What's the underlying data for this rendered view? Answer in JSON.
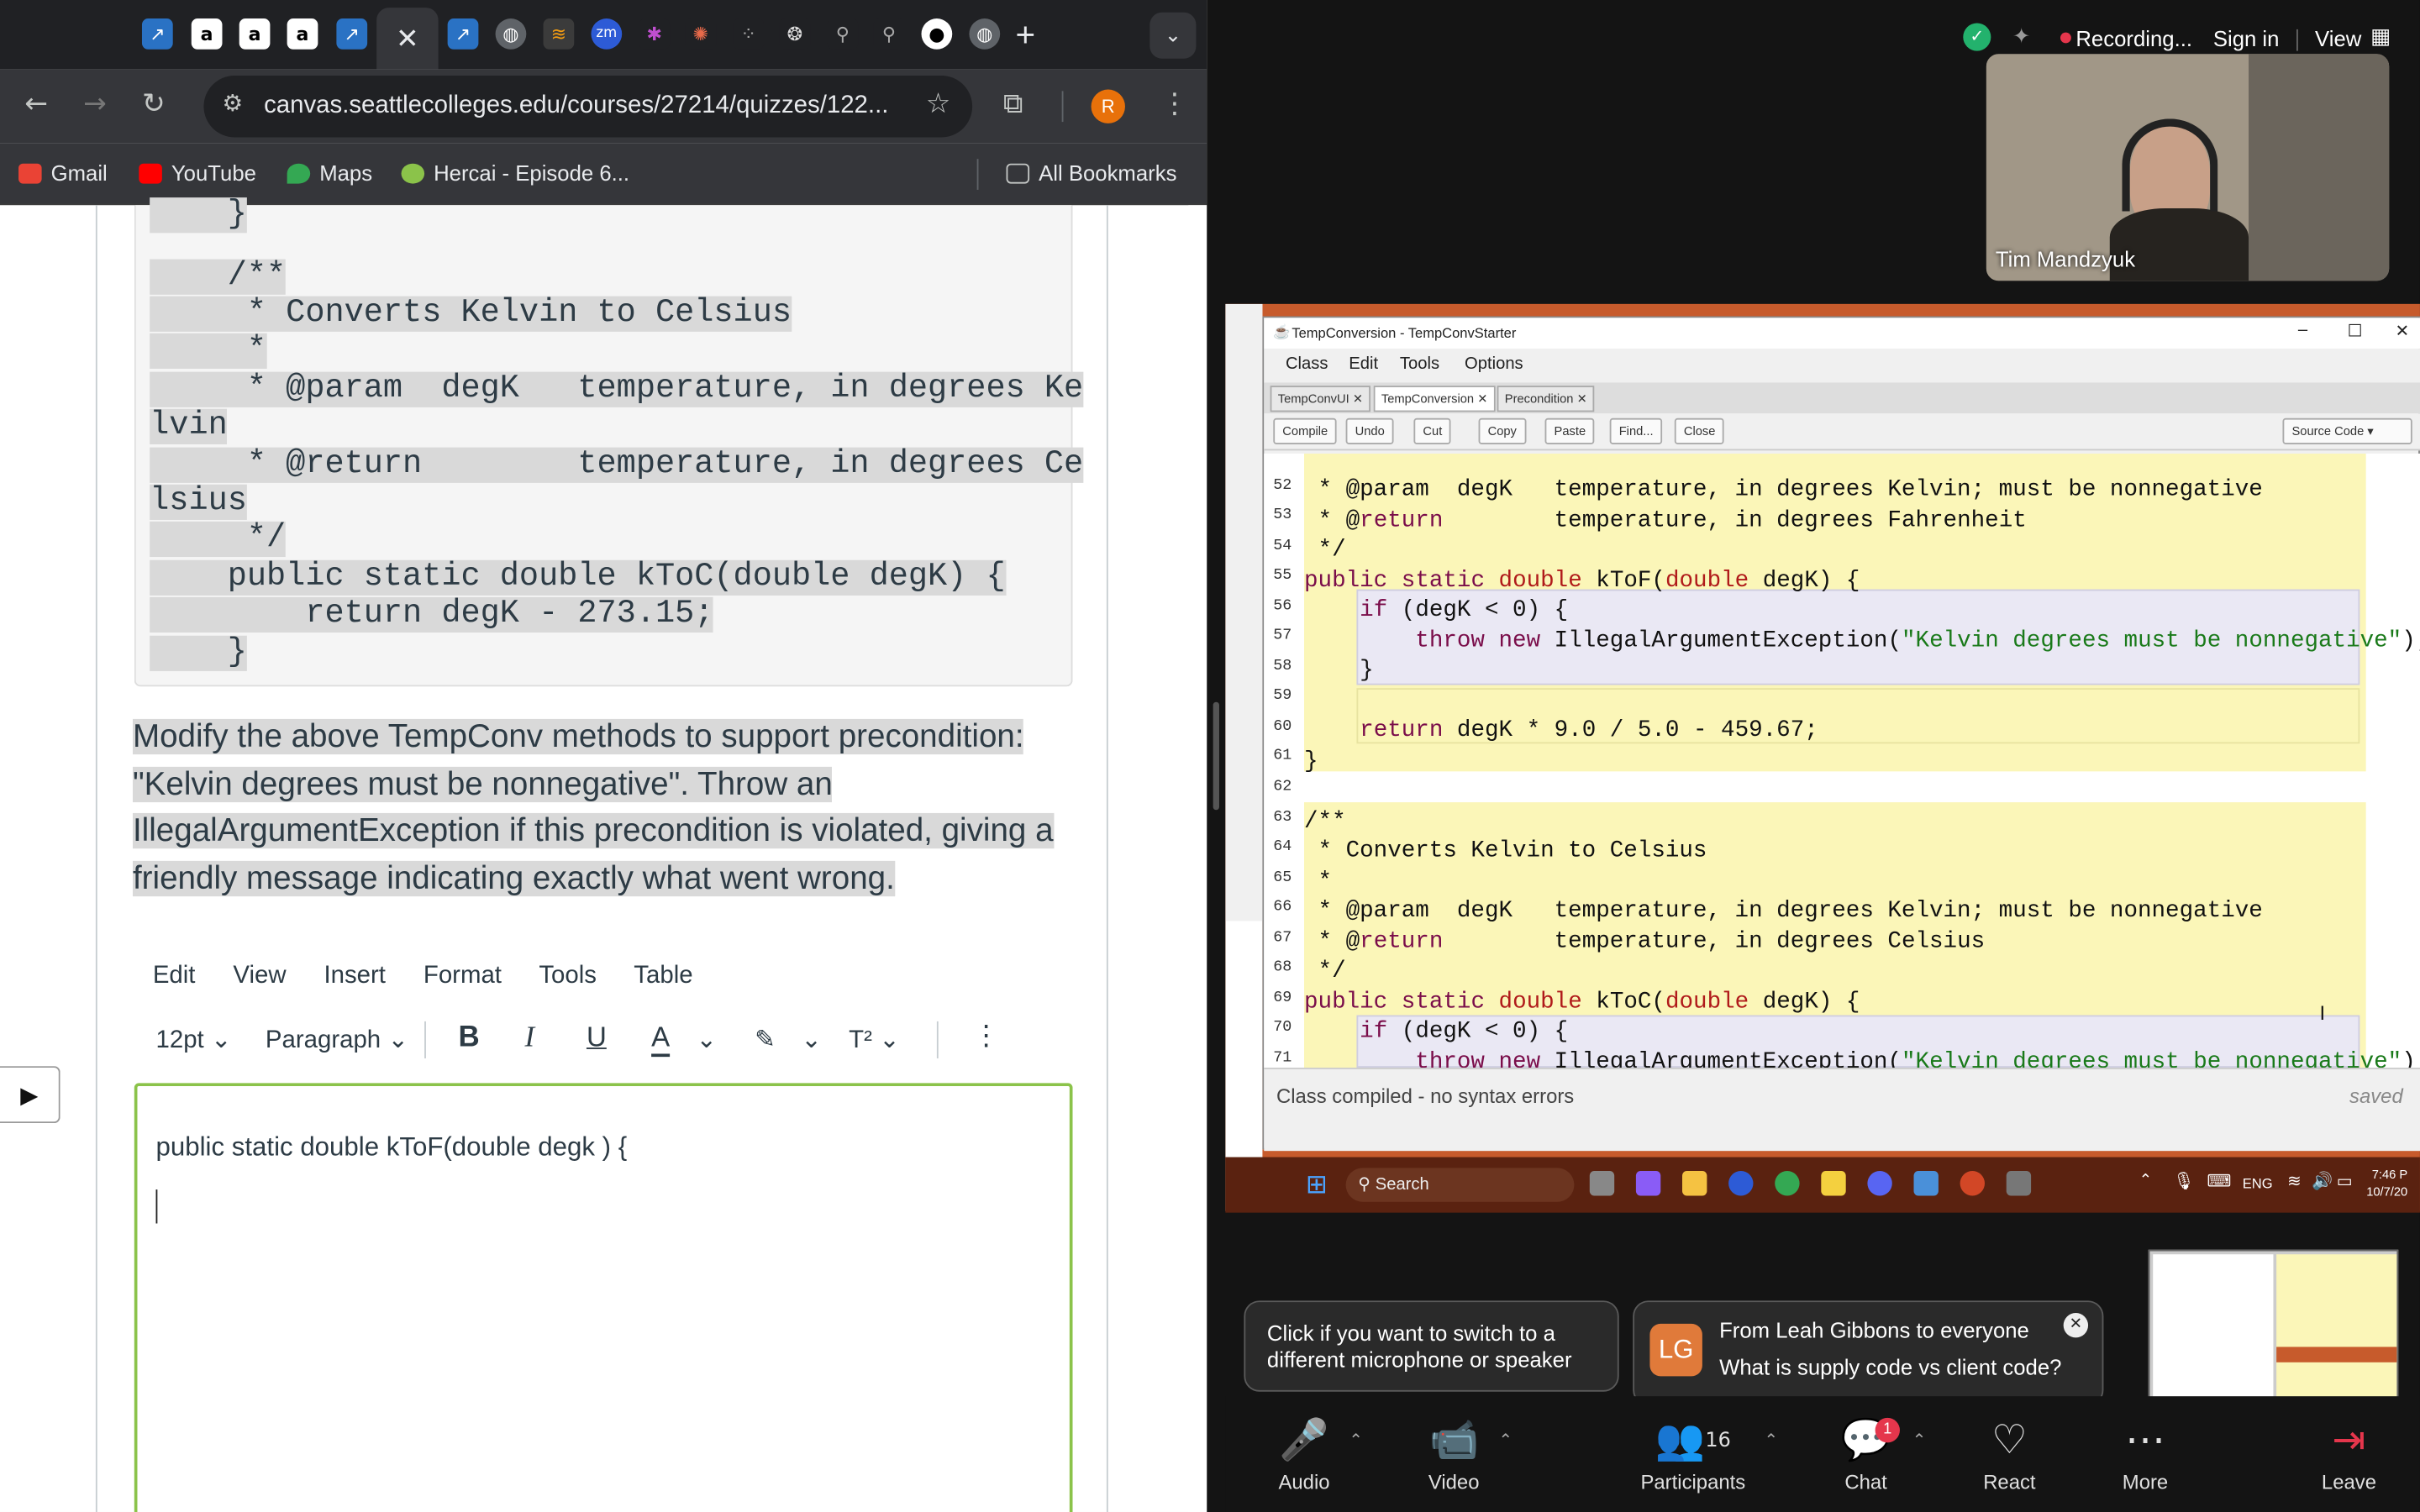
{
  "browser": {
    "url": "canvas.seattlecolleges.edu/courses/27214/quizzes/122...",
    "avatar_letter": "R",
    "bookmarks": [
      {
        "label": "Gmail",
        "color": "#ea4335"
      },
      {
        "label": "YouTube",
        "color": "#ff0000"
      },
      {
        "label": "Maps",
        "color": "#34a853"
      },
      {
        "label": "Hercai - Episode 6...",
        "color": "#8bc34a"
      }
    ],
    "all_bookmarks": "All Bookmarks",
    "close_tab": "✕",
    "new_tab": "+"
  },
  "canvas": {
    "code_lines": [
      "    }",
      "    /**",
      "     * Converts Kelvin to Celsius",
      "     *",
      "     * @param  degK   temperature, in degrees Ke",
      "lvin",
      "     * @return        temperature, in degrees Ce",
      "lsius",
      "     */",
      "    public static double kToC(double degK) {",
      "        return degK - 273.15;",
      "    }"
    ],
    "question": "Modify the above TempConv methods to support precondition: \"Kelvin degrees must be nonnegative\". Throw an IllegalArgumentException if this precondition is violated, giving a friendly message indicating exactly what went wrong.",
    "editor_menu": [
      "Edit",
      "View",
      "Insert",
      "Format",
      "Tools",
      "Table"
    ],
    "font_size": "12pt",
    "block_format": "Paragraph",
    "editor_text": "public static double kToF(double degk ) {"
  },
  "zoom": {
    "recording": "Recording...",
    "sign_in": "Sign in",
    "view": "View",
    "participant_name": "Tim Mandzyuk",
    "mic_tip": "Click if you want to switch to a different microphone or speaker",
    "chat_from": "From Leah Gibbons to everyone",
    "chat_message": "What is supply code vs client code?",
    "chat_initials": "LG",
    "participants_count": "16",
    "chat_badge": "1",
    "controls": {
      "audio": "Audio",
      "video": "Video",
      "participants": "Participants",
      "chat": "Chat",
      "react": "React",
      "more": "More",
      "leave": "Leave"
    }
  },
  "bluej": {
    "window_title": "TempConversion - TempConvStarter",
    "menu": [
      "Class",
      "Edit",
      "Tools",
      "Options"
    ],
    "tabs": [
      "TempConvUI",
      "TempConversion",
      "Precondition"
    ],
    "buttons": [
      "Compile",
      "Undo",
      "Cut",
      "Copy",
      "Paste",
      "Find...",
      "Close"
    ],
    "view_select": "Source Code",
    "line_numbers": [
      "52",
      "53",
      "54",
      "55",
      "56",
      "57",
      "58",
      "59",
      "60",
      "61",
      "62",
      "63",
      "64",
      "65",
      "66",
      "67",
      "68",
      "69",
      "70",
      "71"
    ],
    "code_lines": [
      " * @param  degK   temperature, in degrees Kelvin; must be nonnegative",
      " * @return        temperature, in degrees Fahrenheit",
      " */",
      "public static double kToF(double degK) {",
      "    if (degK < 0) {",
      "        throw new IllegalArgumentException(\"Kelvin degrees must be nonnegative\");",
      "    }",
      "",
      "    return degK * 9.0 / 5.0 - 459.67;",
      "}",
      "",
      "/**",
      " * Converts Kelvin to Celsius",
      " *",
      " * @param  degK   temperature, in degrees Kelvin; must be nonnegative",
      " * @return        temperature, in degrees Celsius",
      " */",
      "public static double kToC(double degK) {",
      "    if (degK < 0) {",
      "        throw new IllegalArgumentException(\"Kelvin degrees must be nonnegative\");"
    ],
    "status": "Class compiled - no syntax errors",
    "saved": "saved"
  },
  "windows_taskbar": {
    "search": "Search",
    "lang": "ENG",
    "time": "7:46 P",
    "date": "10/7/20"
  }
}
